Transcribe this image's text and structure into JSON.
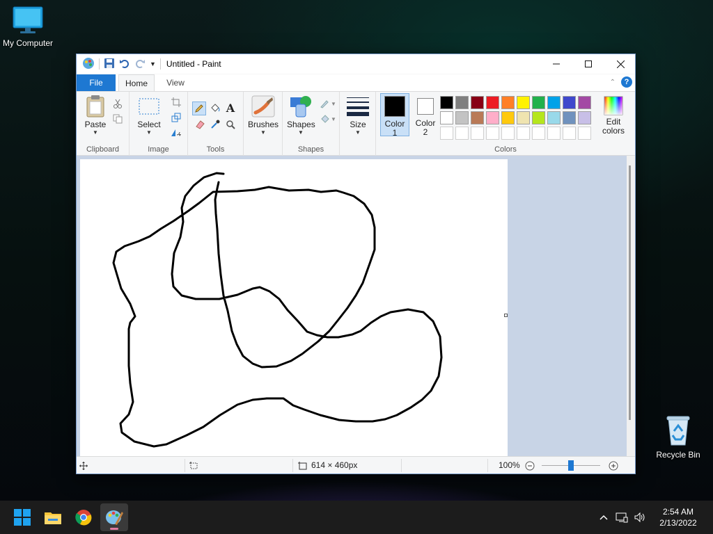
{
  "desktop": {
    "my_computer_label": "My Computer",
    "recycle_bin_label": "Recycle Bin"
  },
  "window": {
    "title": "Untitled - Paint"
  },
  "tabs": {
    "file": "File",
    "home": "Home",
    "view": "View"
  },
  "ribbon": {
    "clipboard": {
      "paste_label": "Paste",
      "group_label": "Clipboard"
    },
    "image": {
      "select_label": "Select",
      "group_label": "Image"
    },
    "tools": {
      "group_label": "Tools"
    },
    "brushes": {
      "label": "Brushes"
    },
    "shapes": {
      "label": "Shapes",
      "group_label": "Shapes"
    },
    "size": {
      "label": "Size"
    },
    "colors": {
      "color1_label_line1": "Color",
      "color1_label_line2": "1",
      "color2_label_line1": "Color",
      "color2_label_line2": "2",
      "edit_colors_line1": "Edit",
      "edit_colors_line2": "colors",
      "group_label": "Colors",
      "color1": "#000000",
      "color2": "#ffffff",
      "palette_row1": [
        "#000000",
        "#7f7f7f",
        "#880015",
        "#ed1c24",
        "#ff7f27",
        "#fff200",
        "#22b14c",
        "#00a2e8",
        "#3f48cc",
        "#a349a4"
      ],
      "palette_row2": [
        "#ffffff",
        "#c3c3c3",
        "#b97a57",
        "#ffaec9",
        "#ffc90e",
        "#efe4b0",
        "#b5e61d",
        "#99d9ea",
        "#7092be",
        "#c8bfe7"
      ]
    }
  },
  "status": {
    "image_size": "614 × 460px",
    "zoom": "100%"
  },
  "taskbar": {
    "time": "2:54 AM",
    "date": "2/13/2022"
  }
}
